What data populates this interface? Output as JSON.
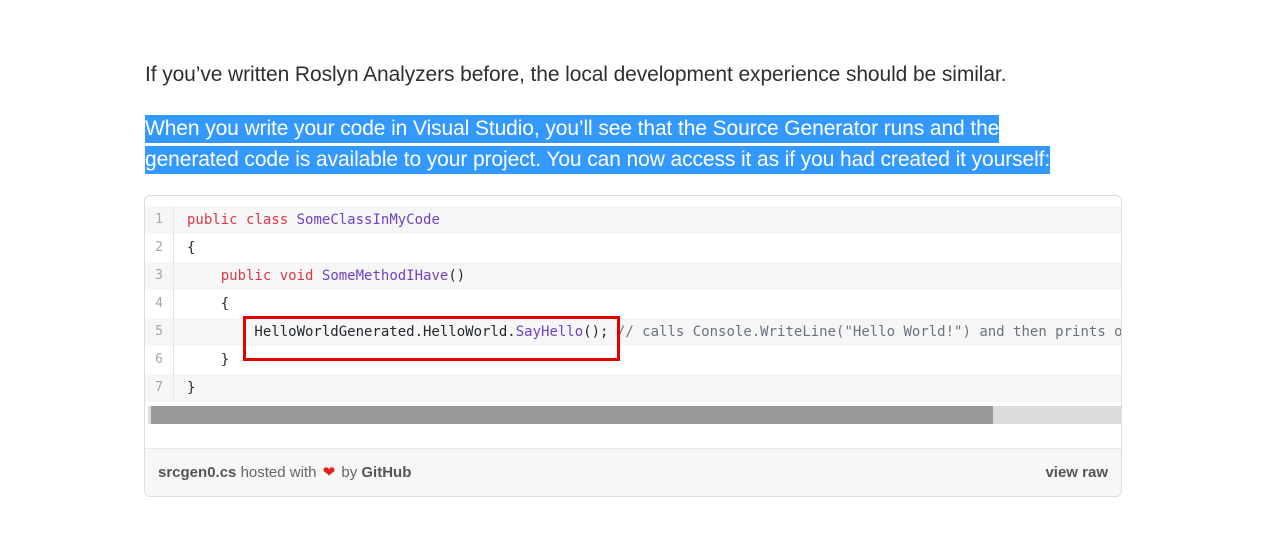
{
  "article": {
    "paragraph1": "If you’ve written Roslyn Analyzers before, the local development experience should be similar.",
    "paragraph2_line1": "When you write your code in Visual Studio, you’ll see that the Source Generator runs and the",
    "paragraph2_line2": "generated code is available to your project. You can now access it as if you had created it yourself:"
  },
  "gist": {
    "lines": [
      {
        "num": "1",
        "parts": [
          {
            "t": "public",
            "c": "kw"
          },
          {
            "t": " "
          },
          {
            "t": "class",
            "c": "kw"
          },
          {
            "t": " "
          },
          {
            "t": "SomeClassInMyCode",
            "c": "nm"
          }
        ]
      },
      {
        "num": "2",
        "parts": [
          {
            "t": "{"
          }
        ]
      },
      {
        "num": "3",
        "parts": [
          {
            "t": "    "
          },
          {
            "t": "public",
            "c": "kw"
          },
          {
            "t": " "
          },
          {
            "t": "void",
            "c": "kw"
          },
          {
            "t": " "
          },
          {
            "t": "SomeMethodIHave",
            "c": "nm"
          },
          {
            "t": "()"
          }
        ]
      },
      {
        "num": "4",
        "parts": [
          {
            "t": "    {"
          }
        ]
      },
      {
        "num": "5",
        "parts": [
          {
            "t": "        HelloWorldGenerated.HelloWorld."
          },
          {
            "t": "SayHello",
            "c": "nm"
          },
          {
            "t": "(); "
          },
          {
            "t": "// calls Console.WriteLine(\"Hello World!\") and then prints out syntax trees",
            "c": "cm"
          }
        ]
      },
      {
        "num": "6",
        "parts": [
          {
            "t": "    }"
          }
        ]
      },
      {
        "num": "7",
        "parts": [
          {
            "t": "}"
          }
        ]
      }
    ],
    "scroll_position": 0.87,
    "filename": "srcgen0.cs",
    "hosted_text": "hosted with",
    "heart_icon": "heart-icon",
    "by_text": "by",
    "github_text": "GitHub",
    "view_raw": "view raw"
  },
  "colors": {
    "selection": "#3399ff",
    "keyword": "#d73a49",
    "entity": "#6f42c1",
    "comment": "#6a737d",
    "highlight_box": "#e00000",
    "heart": "#e02020"
  }
}
